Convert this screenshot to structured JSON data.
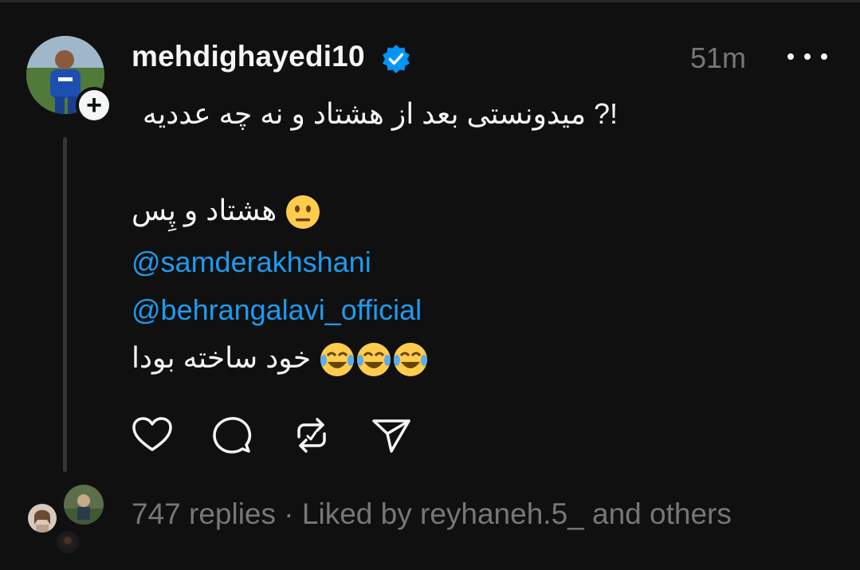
{
  "post": {
    "username": "mehdighayedi10",
    "verified": true,
    "time": "51m",
    "lines": {
      "l1": "!? میدونستی بعد از هشتاد و نه چه عددیه",
      "l2_text": "هشتاد و پِس",
      "mention1": "@samderakhshani",
      "mention2": "@behrangalavi_official",
      "l5_text": "خود ساخته بودا"
    },
    "emoji": {
      "neutral": "neutral-face",
      "laughing": [
        "tears-of-joy",
        "tears-of-joy",
        "tears-of-joy"
      ]
    }
  },
  "actions": [
    "like",
    "reply",
    "repost",
    "share"
  ],
  "footer": {
    "replies": "747 replies",
    "separator": " · ",
    "liked_by": "Liked by reyhaneh.5_ and others"
  },
  "colors": {
    "background": "#101010",
    "text": "#f3f5f7",
    "secondary": "#777777",
    "mention": "#1d9bf0",
    "verified": "#0095f6"
  }
}
